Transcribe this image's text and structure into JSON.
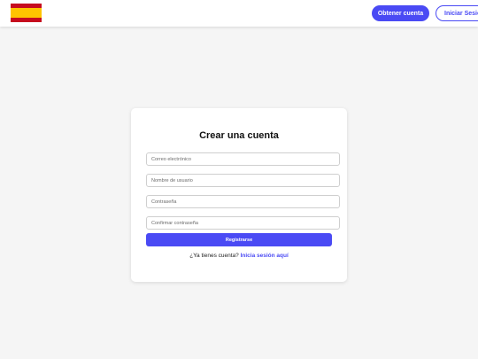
{
  "header": {
    "flag_icon": "spain-flag-icon",
    "primary_button": "Obtener cuenta",
    "secondary_button": "Iniciar Sesión"
  },
  "form": {
    "title": "Crear una cuenta",
    "email_placeholder": "Correo electrónico",
    "username_placeholder": "Nombre de usuario",
    "password_placeholder": "Contraseña",
    "confirm_placeholder": "Confirmar contraseña",
    "submit_label": "Registrarse",
    "login_prompt": "¿Ya tienes cuenta?",
    "login_link": "Inicia sesión aquí"
  },
  "colors": {
    "accent": "#4a4af4",
    "background": "#f5f5f5",
    "flag_red": "#c60b1e",
    "flag_yellow": "#ffc400"
  }
}
